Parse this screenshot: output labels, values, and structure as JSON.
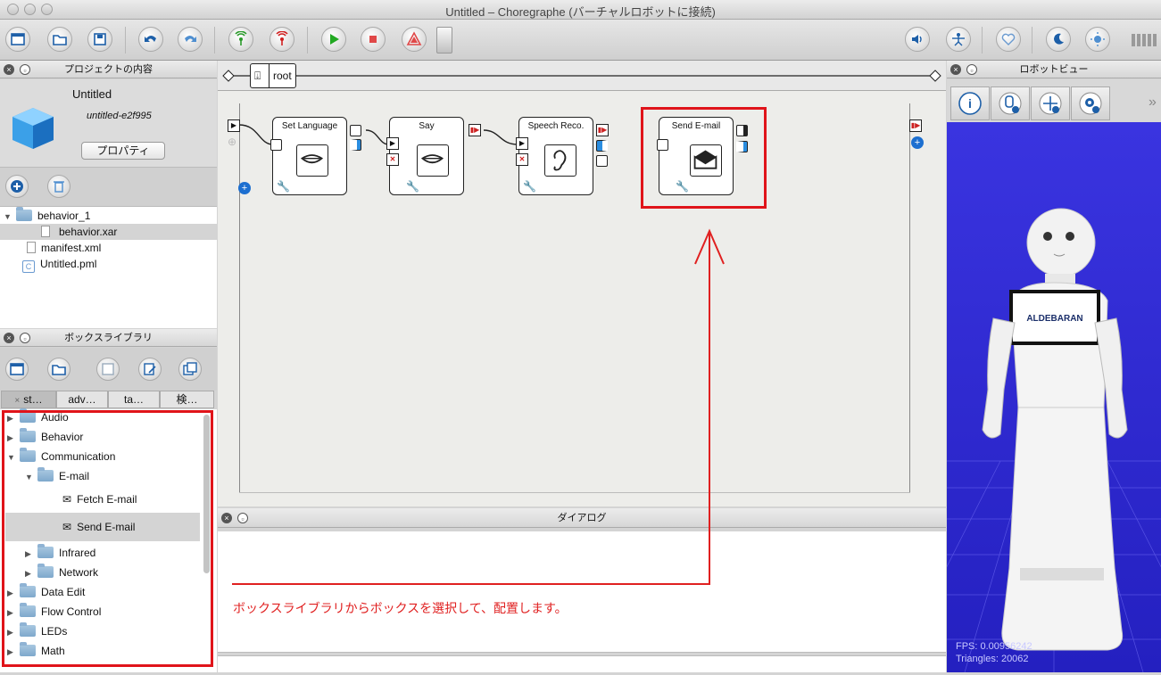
{
  "window": {
    "title": "Untitled – Choregraphe (バーチャルロボットに接続)"
  },
  "toolbar": {
    "buttons": [
      "new-project",
      "open-project",
      "save-project",
      "undo",
      "redo",
      "connect",
      "disconnect",
      "play",
      "stop",
      "debug",
      "slider"
    ],
    "right_buttons": [
      "volume",
      "robot-posture",
      "heart",
      "sleep",
      "settings",
      "battery"
    ]
  },
  "project": {
    "header": "プロジェクトの内容",
    "name": "Untitled",
    "id": "untitled-e2f995",
    "properties_button": "プロパティ",
    "tree": [
      {
        "label": "behavior_1",
        "type": "folder",
        "expanded": true
      },
      {
        "label": "behavior.xar",
        "type": "file",
        "selected": true
      },
      {
        "label": "manifest.xml",
        "type": "file"
      },
      {
        "label": "Untitled.pml",
        "type": "pml-file"
      }
    ]
  },
  "library": {
    "header": "ボックスライブラリ",
    "tabs": [
      "st…",
      "adv…",
      "ta…",
      "検…"
    ],
    "tree": [
      {
        "label": "Audio",
        "expanded": false
      },
      {
        "label": "Behavior",
        "expanded": false
      },
      {
        "label": "Communication",
        "expanded": true
      },
      {
        "label": "E-mail",
        "expanded": true
      },
      {
        "label": "Fetch E-mail",
        "type": "box"
      },
      {
        "label": "Send E-mail",
        "type": "box",
        "selected": true
      },
      {
        "label": "Infrared",
        "expanded": false
      },
      {
        "label": "Network",
        "expanded": false
      },
      {
        "label": "Data Edit",
        "expanded": false
      },
      {
        "label": "Flow Control",
        "expanded": false
      },
      {
        "label": "LEDs",
        "expanded": false
      },
      {
        "label": "Math",
        "expanded": false
      }
    ]
  },
  "flow": {
    "breadcrumb": "root",
    "boxes": [
      {
        "title": "Set Language",
        "icon": "mouth-icon"
      },
      {
        "title": "Say",
        "icon": "mouth-icon"
      },
      {
        "title": "Speech Reco.",
        "icon": "ear-icon"
      },
      {
        "title": "Send E-mail",
        "icon": "email-icon"
      }
    ]
  },
  "dialog": {
    "header": "ダイアログ",
    "annotation": "ボックスライブラリからボックスを選択して、配置します。",
    "annotation_color": "#e02020"
  },
  "robotview": {
    "header": "ロボットビュー",
    "logo": "ALDEBARAN",
    "fps": "FPS: 0.00956242",
    "triangles": "Triangles: 20062",
    "bg_color": "#3a34e0"
  }
}
